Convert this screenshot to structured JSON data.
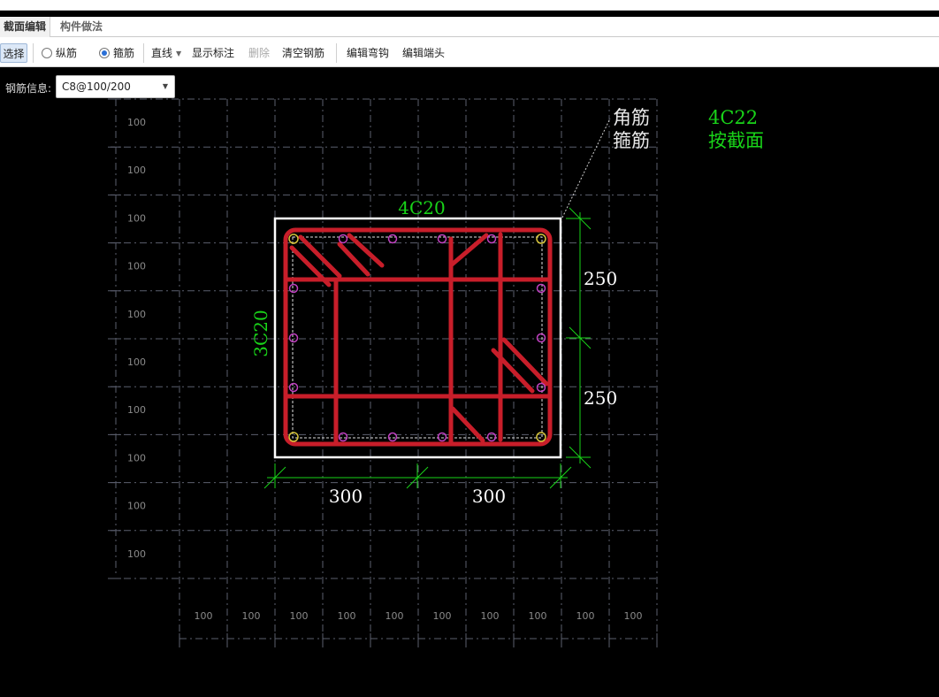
{
  "tabs": [
    {
      "label": "截面编辑",
      "active": true
    },
    {
      "label": "构件做法",
      "active": false
    }
  ],
  "toolbar": {
    "select_label": "选择",
    "radio_longitudinal": "纵筋",
    "radio_stirrup": "箍筋",
    "line_label": "直线",
    "show_annotation": "显示标注",
    "delete_label": "删除",
    "clear_rebar": "清空钢筋",
    "edit_hook": "编辑弯钩",
    "edit_end": "编辑端头"
  },
  "rebar_info": {
    "label": "钢筋信息:",
    "value": "C8@100/200"
  },
  "drawing": {
    "grid_left_labels": [
      "100",
      "100",
      "100",
      "100",
      "100",
      "100",
      "100",
      "100",
      "100",
      "100"
    ],
    "grid_bottom_labels": [
      "100",
      "100",
      "100",
      "100",
      "100",
      "100",
      "100",
      "100",
      "100",
      "100"
    ],
    "top_rebar_label": "4C20",
    "side_rebar_label": "3C20",
    "dim_right": [
      "250",
      "250"
    ],
    "dim_bottom": [
      "300",
      "300"
    ],
    "legend": [
      {
        "key": "角筋",
        "value": "4C22"
      },
      {
        "key": "箍筋",
        "value": "按截面"
      }
    ]
  },
  "colors": {
    "rebar": "#c81e2a",
    "dimension": "#19d419",
    "grid": "#5b5f6e",
    "section_outline": "#ffffff",
    "bar_dot": "#c040c0",
    "corner_dot": "#d7c43a"
  }
}
